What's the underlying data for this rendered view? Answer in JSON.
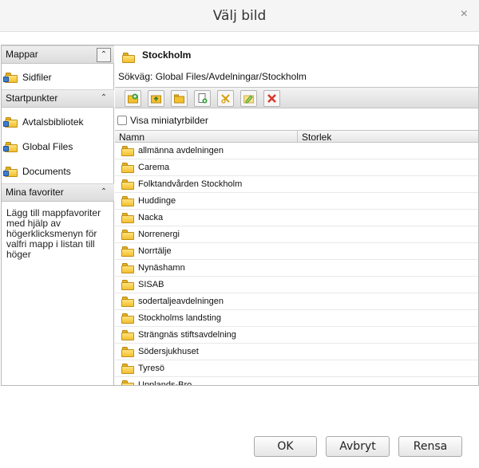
{
  "dialog": {
    "title": "Välj bild",
    "close_glyph": "×"
  },
  "left": {
    "folders_header": "Mappar",
    "folders_items": [
      {
        "label": "Sidfiler",
        "icon": "shared-folder-icon"
      }
    ],
    "startpoints_header": "Startpunkter",
    "startpoints_items": [
      {
        "label": "Avtalsbibliotek",
        "icon": "shared-folder-icon"
      },
      {
        "label": "Global Files",
        "icon": "shared-folder-icon"
      },
      {
        "label": "Documents",
        "icon": "shared-folder-icon"
      }
    ],
    "favorites_header": "Mina favoriter",
    "favorites_text": "Lägg till mappfavoriter med hjälp av högerklicksmenyn för valfri mapp i listan till höger",
    "collapse_glyph": "⌃"
  },
  "right": {
    "location": "Stockholm",
    "path": "Sökväg: Global Files/Avdelningar/Stockholm",
    "thumbnails_label": "Visa miniatyrbilder",
    "thumbnails_checked": false,
    "columns": {
      "name": "Namn",
      "size": "Storlek"
    },
    "toolbar": [
      "new-folder-icon",
      "folder-up-icon",
      "open-folder-icon",
      "add-file-icon",
      "cut-icon",
      "rename-icon",
      "delete-icon"
    ],
    "rows": [
      "allmänna avdelningen",
      "Carema",
      "Folktandvården Stockholm",
      "Huddinge",
      "Nacka",
      "Norrenergi",
      "Norrtälje",
      "Nynäshamn",
      "SISAB",
      "sodertaljeavdelningen",
      "Stockholms landsting",
      "Strängnäs stiftsavdelning",
      "Södersjukhuset",
      "Tyresö",
      "Upplands-Bro"
    ]
  },
  "buttons": {
    "ok": "OK",
    "cancel": "Avbryt",
    "clear": "Rensa"
  },
  "colors": {
    "folder": "#f3c030",
    "delete": "#d63b2f",
    "accent_green": "#3aa33a"
  }
}
